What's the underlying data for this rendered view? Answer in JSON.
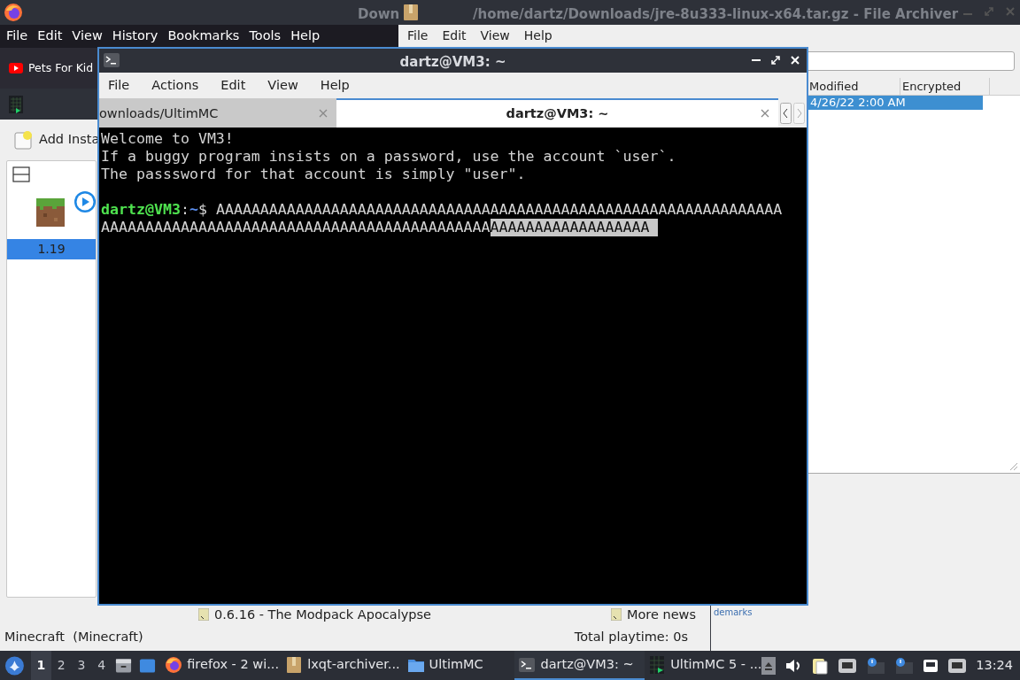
{
  "firefox": {
    "title": "Down",
    "menu": [
      "File",
      "Edit",
      "View",
      "History",
      "Bookmarks",
      "Tools",
      "Help"
    ],
    "bookmarks": [
      {
        "label": "Pets For Kid"
      }
    ],
    "page_text": "demarks"
  },
  "ultimmc": {
    "add_instance": "Add Insta",
    "instances": [
      {
        "label": "1.19",
        "selected": true
      }
    ],
    "news": "0.6.16 - The Modpack Apocalypse",
    "more_news": "More news",
    "status": "Minecraft  (Minecraft)",
    "playtime": "Total playtime: 0s"
  },
  "archiver": {
    "title": "/home/dartz/Downloads/jre-8u333-linux-x64.tar.gz - File Archiver",
    "menu": [
      "File",
      "Edit",
      "View",
      "Help"
    ],
    "columns": [
      "Modified",
      "Encrypted"
    ],
    "rows": [
      {
        "modified": "4/26/22 2:00 AM",
        "selected": true
      }
    ]
  },
  "terminal": {
    "title": "dartz@VM3: ~",
    "menu": [
      "File",
      "Actions",
      "Edit",
      "View",
      "Help"
    ],
    "tabs": [
      {
        "label": "ownloads/UltimMC",
        "selected": false
      },
      {
        "label": "dartz@VM3: ~",
        "selected": true
      }
    ],
    "lines": [
      {
        "kind": "text",
        "text": "Welcome to VM3!"
      },
      {
        "kind": "text",
        "text": "If a buggy program insists on a password, use the account `user`."
      },
      {
        "kind": "text",
        "text": "The passsword for that account is simply \"user\"."
      },
      {
        "kind": "blank"
      },
      {
        "kind": "prompt",
        "user": "dartz@VM3",
        "separator": ":",
        "path": "~",
        "symbol": "$",
        "text": "AAAAAAAAAAAAAAAAAAAAAAAAAAAAAAAAAAAAAAAAAAAAAAAAAAAAAAAAAAAAAAAA"
      },
      {
        "kind": "text",
        "text": "AAAAAAAAAAAAAAAAAAAAAAAAAAAAAAAAAAAAAAAAAAAA",
        "selected_text": "AAAAAAAAAAAAAAAAAA"
      }
    ]
  },
  "taskbar": {
    "desktops": [
      {
        "label": "1",
        "selected": true
      },
      {
        "label": "2",
        "selected": false
      },
      {
        "label": "3",
        "selected": false
      },
      {
        "label": "4",
        "selected": false
      }
    ],
    "tasks": [
      {
        "kind": "firefox",
        "label": "firefox - 2 wi...",
        "selected": false
      },
      {
        "kind": "archive",
        "label": "lxqt-archiver...",
        "selected": false
      },
      {
        "kind": "folder",
        "label": "UltimMC",
        "selected": false
      },
      {
        "kind": "terminal",
        "label": "dartz@VM3: ~",
        "selected": true
      },
      {
        "kind": "launcher",
        "label": "UltimMC 5 - ...",
        "selected": false
      }
    ],
    "clock": "13:24"
  }
}
